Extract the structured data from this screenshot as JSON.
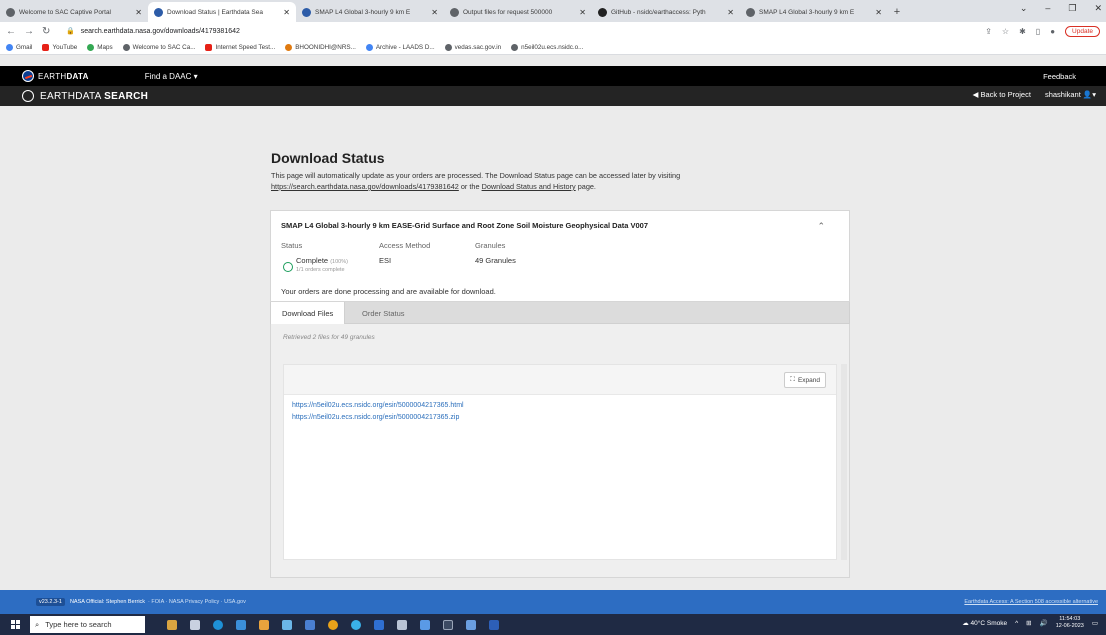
{
  "browser": {
    "tabs": [
      {
        "title": "Welcome to SAC Captive Portal",
        "icon": "globe-icon",
        "active": false
      },
      {
        "title": "Download Status | Earthdata Sea",
        "icon": "earthdata-icon",
        "active": true
      },
      {
        "title": "SMAP L4 Global 3-hourly 9 km E",
        "icon": "nsidc-icon",
        "active": false
      },
      {
        "title": "Output files for request 500000",
        "icon": "globe-icon",
        "active": false
      },
      {
        "title": "GitHub - nsidc/earthaccess: Pyth",
        "icon": "github-icon",
        "active": false
      },
      {
        "title": "SMAP L4 Global 3-hourly 9 km E",
        "icon": "globe-icon",
        "active": false
      }
    ],
    "url": "search.earthdata.nasa.gov/downloads/4179381642",
    "update_label": "Update",
    "bookmarks": [
      "Gmail",
      "YouTube",
      "Maps",
      "Welcome to SAC Ca...",
      "Internet Speed Test...",
      "BHOONIDHI@NRS...",
      "Archive - LAADS D...",
      "vedas.sac.gov.in",
      "n5eil02u.ecs.nsidc.o..."
    ]
  },
  "earthdata_bar": {
    "logo_bold": "DATA",
    "logo_prefix": "EARTH",
    "find_daac": "Find a DAAC ▾",
    "feedback": "Feedback"
  },
  "eds_bar": {
    "logo_prefix": "EARTHDATA ",
    "logo_bold": "SEARCH",
    "back_to_project": "Back to Project",
    "user": "shashikant"
  },
  "page": {
    "heading": "Download Status",
    "intro_text": "This page will automatically update as your orders are processed. The Download Status page can be accessed later by visiting",
    "intro_link": "https://search.earthdata.nasa.gov/downloads/4179381642",
    "intro_or": " or the ",
    "intro_link2": "Download Status and History",
    "intro_end": " page."
  },
  "order": {
    "title": "SMAP L4 Global 3-hourly 9 km EASE-Grid Surface and Root Zone Soil Moisture Geophysical Data V007",
    "status_label": "Status",
    "status_value": "Complete",
    "status_pct": "(100%)",
    "status_sub": "1/1 orders complete",
    "access_label": "Access Method",
    "access_value": "ESI",
    "granules_label": "Granules",
    "granules_value": "49 Granules",
    "done_message": "Your orders are done processing and are available for download."
  },
  "download_tabs": {
    "files": "Download Files",
    "status": "Order Status"
  },
  "files": {
    "retrieved": "Retrieved 2 files for 49 granules",
    "expand": "Expand",
    "links": [
      "https://n5eil02u.ecs.nsidc.org/esir/5000004217365.html",
      "https://n5eil02u.ecs.nsidc.org/esir/5000004217365.zip"
    ]
  },
  "footer": {
    "version": "v23.2.3-1",
    "official": "NASA Official: Stephen Berrick",
    "links": "· FOIA · NASA Privacy Policy · USA.gov",
    "right": "Earthdata Access: A Section 508 accessible alternative"
  },
  "taskbar": {
    "search_placeholder": "Type here to search",
    "weather": "40°C  Smoke",
    "time": "11:54:03",
    "date": "12-06-2023"
  }
}
